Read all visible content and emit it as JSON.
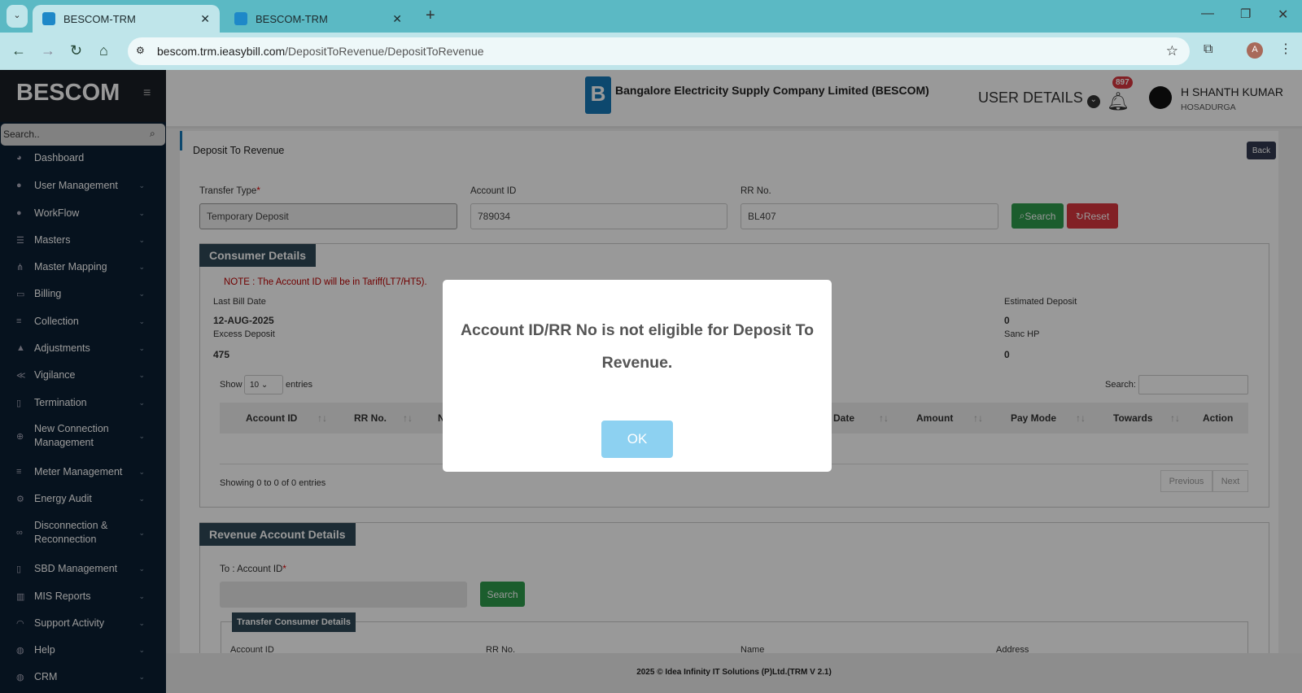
{
  "browser": {
    "tabs": [
      {
        "title": "BESCOM-TRM"
      },
      {
        "title": "BESCOM-TRM"
      }
    ],
    "url_domain": "bescom.trm.ieasybill.com",
    "url_path": "/DepositToRevenue/DepositToRevenue",
    "profile_initial": "A"
  },
  "sidebar": {
    "brand": "BESCOM",
    "search_placeholder": "Search..",
    "items": [
      {
        "label": "Dashboard",
        "icon": "dashboard-icon",
        "glyph": "◕"
      },
      {
        "label": "User Management",
        "icon": "user-icon",
        "glyph": "●"
      },
      {
        "label": "WorkFlow",
        "icon": "user-icon",
        "glyph": "●"
      },
      {
        "label": "Masters",
        "icon": "list-icon",
        "glyph": "☰"
      },
      {
        "label": "Master Mapping",
        "icon": "sitemap-icon",
        "glyph": "⋔"
      },
      {
        "label": "Billing",
        "icon": "monitor-icon",
        "glyph": "▭"
      },
      {
        "label": "Collection",
        "icon": "list-icon",
        "glyph": "≡"
      },
      {
        "label": "Adjustments",
        "icon": "adjust-icon",
        "glyph": "▲"
      },
      {
        "label": "Vigilance",
        "icon": "vk-icon",
        "glyph": "≪"
      },
      {
        "label": "Termination",
        "icon": "trash-icon",
        "glyph": "▯"
      },
      {
        "label": "New Connection Management",
        "icon": "plus-circle-icon",
        "glyph": "⊕"
      },
      {
        "label": "Meter Management",
        "icon": "list-icon",
        "glyph": "≡"
      },
      {
        "label": "Energy Audit",
        "icon": "gears-icon",
        "glyph": "⚙"
      },
      {
        "label": "Disconnection & Reconnection",
        "icon": "link-icon",
        "glyph": "∞"
      },
      {
        "label": "SBD Management",
        "icon": "mobile-icon",
        "glyph": "▯"
      },
      {
        "label": "MIS Reports",
        "icon": "bar-chart-icon",
        "glyph": "▥"
      },
      {
        "label": "Support Activity",
        "icon": "headset-icon",
        "glyph": "◠"
      },
      {
        "label": "Help",
        "icon": "globe-icon",
        "glyph": "◍"
      },
      {
        "label": "CRM",
        "icon": "globe-icon",
        "glyph": "◍"
      }
    ]
  },
  "header": {
    "company": "Bangalore Electricity Supply Company Limited (BESCOM)",
    "user_details": "USER DETAILS",
    "notification_count": "897",
    "user_name": "H SHANTH KUMAR",
    "user_location": "HOSADURGA"
  },
  "page": {
    "title": "Deposit To Revenue",
    "back": "Back",
    "transfer_type_label": "Transfer Type",
    "transfer_type_value": "Temporary Deposit",
    "account_id_label": "Account ID",
    "account_id_value": "789034",
    "rr_label": "RR No.",
    "rr_value": "BL407",
    "search": "Search",
    "reset": "Reset",
    "consumer_details": {
      "title": "Consumer Details",
      "note": "NOTE : The Account ID will be in Tariff(LT7/HT5).",
      "last_bill_date_label": "Last Bill Date",
      "last_bill_date": "12-AUG-2025",
      "excess_deposit_label": "Excess Deposit",
      "excess_deposit": "475",
      "estimated_deposit_label": "Estimated Deposit",
      "estimated_deposit": "0",
      "sanc_hp_label": "Sanc HP",
      "sanc_hp": "0"
    },
    "table": {
      "show": "Show",
      "entries_value": "10",
      "entries": "entries",
      "search_label": "Search:",
      "columns": [
        "Account ID",
        "RR No.",
        "N",
        "Date",
        "Amount",
        "Pay Mode",
        "Towards",
        "Action"
      ],
      "info": "Showing 0 to 0 of 0 entries",
      "previous": "Previous",
      "next": "Next"
    },
    "revenue": {
      "title": "Revenue Account Details",
      "to_account_label": "To : Account ID",
      "search": "Search",
      "transfer_title": "Transfer Consumer Details",
      "cols": [
        "Account ID",
        "RR No.",
        "Name",
        "Address"
      ]
    }
  },
  "footer": "2025 © Idea Infinity IT Solutions (P)Ltd.(TRM V 2.1)",
  "modal": {
    "message": "Account ID/RR No is not eligible for Deposit To Revenue.",
    "ok": "OK"
  }
}
